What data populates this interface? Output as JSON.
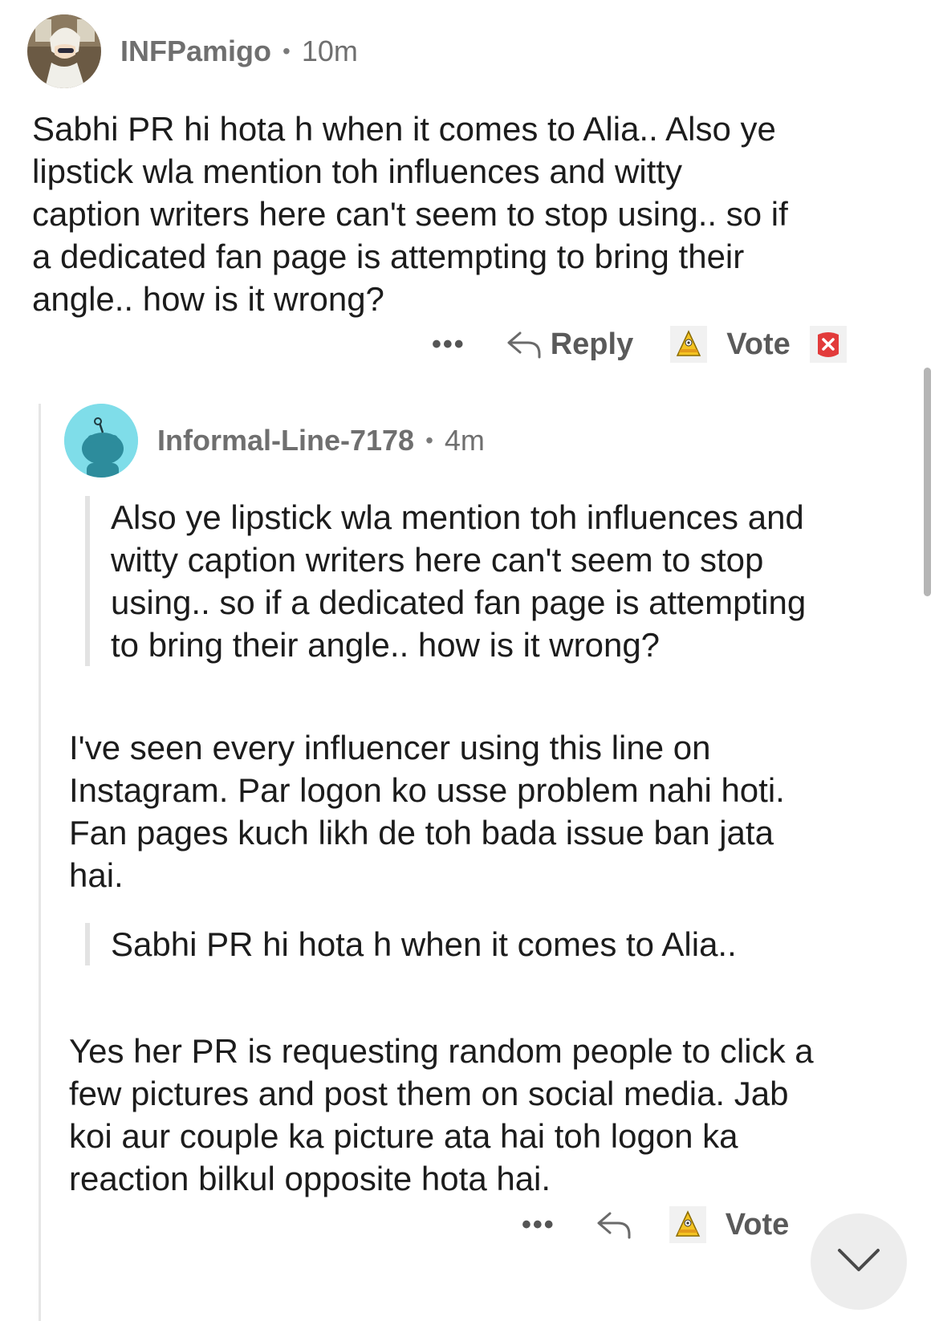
{
  "comment1": {
    "username": "INFPamigo",
    "separator": "•",
    "time": "10m",
    "body_lines": [
      "Sabhi PR hi hota h when it comes to Alia.. Also ye",
      "lipstick  wla mention toh influences and witty",
      "caption writers here can't seem to stop using.. so if",
      "a dedicated fan page is attempting to bring their",
      "angle.. how is it wrong?"
    ],
    "actions": {
      "more": "•••",
      "reply": "Reply",
      "vote": "Vote"
    }
  },
  "comment2": {
    "username": "Informal-Line-7178",
    "separator": "•",
    "time": "4m",
    "quote1_lines": [
      "Also ye lipstick wla mention toh influences and",
      "witty caption writers here can't seem to stop",
      "using.. so if a dedicated fan page is attempting",
      "to bring their angle.. how is it wrong?"
    ],
    "para1_lines": [
      "I've seen every influencer using this line on",
      "Instagram. Par logon ko usse problem nahi hoti.",
      "Fan pages kuch likh de toh bada issue ban jata",
      "hai."
    ],
    "quote2_lines": [
      "Sabhi PR hi hota h when it comes to Alia.."
    ],
    "para2_lines": [
      "Yes her PR is requesting random people to click a",
      "few pictures and post them on social media. Jab",
      "koi aur couple ka picture ata hai toh logon ka",
      "reaction bilkul opposite hota hai."
    ],
    "actions": {
      "more": "•••",
      "vote": "Vote"
    }
  },
  "icons": {
    "upvote": "award-cone-icon",
    "downvote": "red-x-icon",
    "reply": "reply-arrow-icon",
    "scroll_down": "chevron-down-icon"
  }
}
